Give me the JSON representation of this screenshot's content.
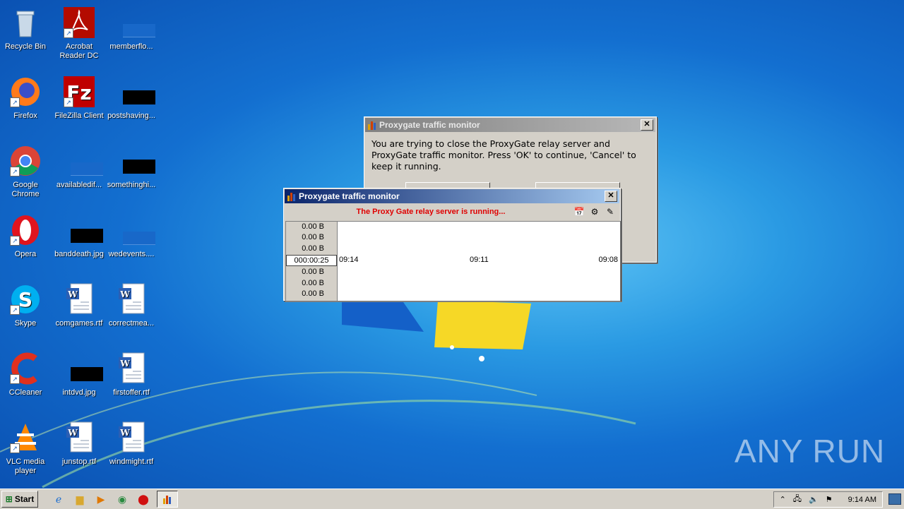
{
  "desktop": {
    "icons": [
      {
        "label": "Recycle Bin"
      },
      {
        "label": "Acrobat Reader DC"
      },
      {
        "label": "memberflo..."
      },
      {
        "label": "Firefox"
      },
      {
        "label": "FileZilla Client"
      },
      {
        "label": "postshaving..."
      },
      {
        "label": "Google Chrome"
      },
      {
        "label": "availabledif..."
      },
      {
        "label": "somethinghi..."
      },
      {
        "label": "Opera"
      },
      {
        "label": "banddeath.jpg"
      },
      {
        "label": "wedevents...."
      },
      {
        "label": "Skype"
      },
      {
        "label": "comgames.rtf"
      },
      {
        "label": "correctmea..."
      },
      {
        "label": "CCleaner"
      },
      {
        "label": "intdvd.jpg"
      },
      {
        "label": "firstoffer.rtf"
      },
      {
        "label": "VLC media player"
      },
      {
        "label": "junstop.rtf"
      },
      {
        "label": "windmight.rtf"
      }
    ]
  },
  "confirm_dialog": {
    "title": "Proxygate traffic monitor",
    "message": "You are trying to close the ProxyGate relay server and ProxyGate traffic monitor.  Press 'OK' to continue,   'Cancel' to keep it running."
  },
  "monitor_window": {
    "title": "Proxygate traffic monitor",
    "status": "The Proxy Gate relay server is running...",
    "upper_values": [
      "0.00 B",
      "0.00 B",
      "0.00 B"
    ],
    "elapsed": "000:00:25",
    "lower_values": [
      "0.00 B",
      "0.00 B",
      "0.00 B"
    ],
    "time_labels": [
      "09:14",
      "09:11",
      "09:08"
    ]
  },
  "taskbar": {
    "start_label": "Start",
    "clock": "9:14 AM"
  },
  "watermark": "ANY RUN"
}
